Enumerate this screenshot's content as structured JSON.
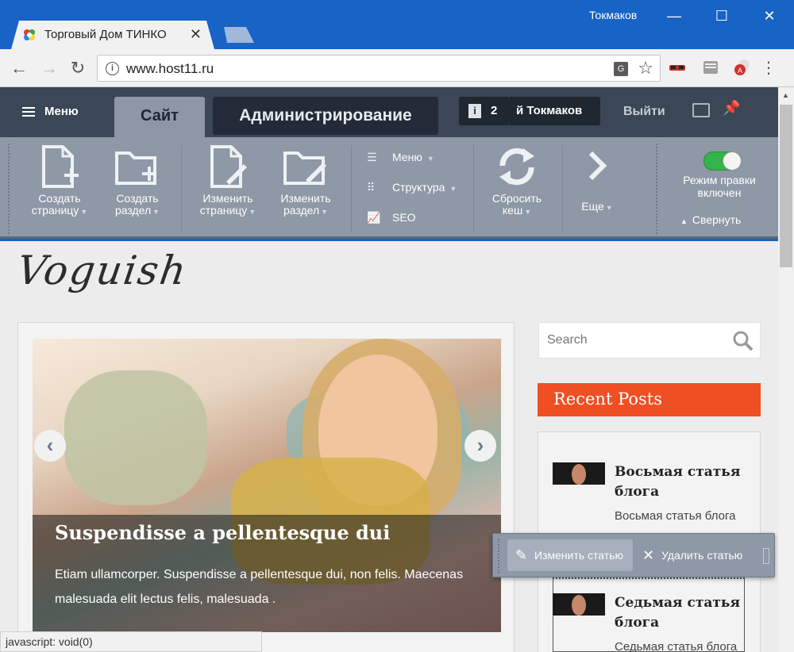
{
  "browser": {
    "tab_title": "Торговый Дом ТИНКО",
    "tab_close": "✕",
    "profile_name": "Токмаков",
    "url": "www.host11.ru",
    "status_text": "javascript: void(0)"
  },
  "admin": {
    "menu_label": "Меню",
    "tab_site": "Сайт",
    "tab_admin": "Администрирование",
    "notifications_count": "2",
    "user_name": "й Токмаков",
    "logout": "Выйти",
    "buttons": {
      "create_page": [
        "Создать",
        "страницу"
      ],
      "create_section": [
        "Создать",
        "раздел"
      ],
      "edit_page": [
        "Изменить",
        "страницу"
      ],
      "edit_section": [
        "Изменить",
        "раздел"
      ],
      "reset_cache": [
        "Сбросить",
        "кеш"
      ],
      "more": "Еще"
    },
    "list": {
      "menu": "Меню",
      "structure": "Структура",
      "seo": "SEO"
    },
    "edit_mode": "Режим правки включен",
    "collapse": "Свернуть",
    "edit_mode_on": true
  },
  "site": {
    "logo": "Voguish",
    "slider": {
      "title": "Suspendisse a pellentesque dui",
      "text": "Etiam ullamcorper. Suspendisse a pellentesque dui, non felis. Maecenas malesuada elit lectus felis, malesuada ."
    },
    "search_placeholder": "Search",
    "recent_posts_title": "Recent Posts",
    "posts": [
      {
        "title": "Восьмая статья блога",
        "excerpt": "Восьмая статья блога"
      },
      {
        "title": "Седьмая статья блога",
        "excerpt": "Седьмая статья блога"
      }
    ],
    "edit_popup": {
      "edit_label": "Изменить статью",
      "delete_label": "Удалить статью"
    }
  },
  "colors": {
    "chrome_blue": "#1763c6",
    "admin_dark": "#3b4656",
    "admin_bar": "#8e98a6",
    "accent_orange": "#f04e23",
    "toggle_green": "#34b44a"
  }
}
